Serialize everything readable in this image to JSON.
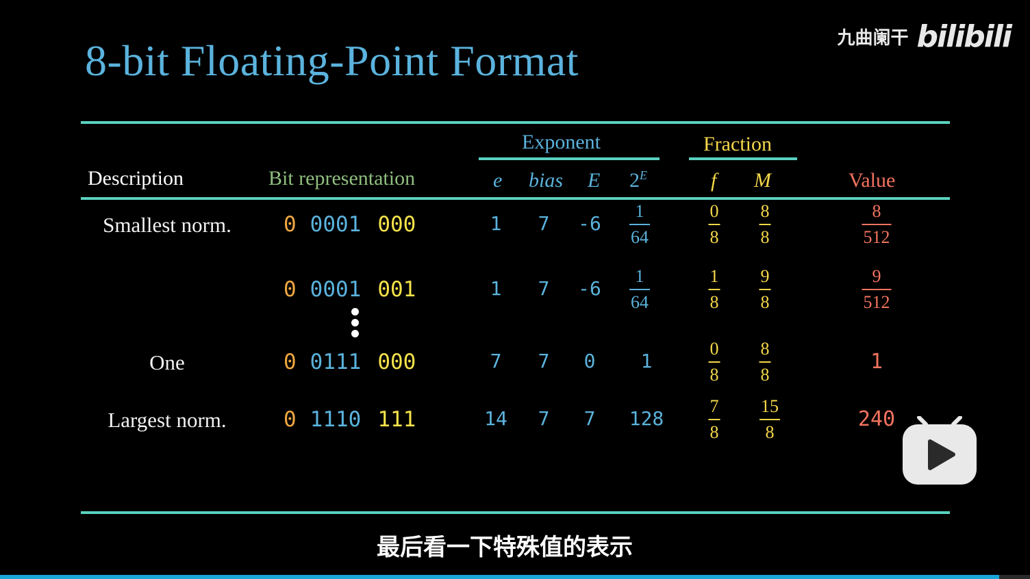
{
  "colors": {
    "title": "#5bb3dd",
    "rule": "#5ad1c0",
    "desc_header": "#ffffff",
    "bitrep_header": "#8fbf7f",
    "exponent": "#5bb3dd",
    "fraction": "#f5d84a",
    "value": "#f2735f",
    "sign": "#f0a840",
    "exp_bits": "#5bb3dd",
    "frac_bits": "#f5e34a"
  },
  "title": "8-bit Floating-Point Format",
  "watermark": {
    "channel": "九曲阑干",
    "logo": "bilibili"
  },
  "headers": {
    "exponent_group": "Exponent",
    "fraction_group": "Fraction",
    "description": "Description",
    "bit_representation": "Bit representation",
    "e": "e",
    "bias": "bias",
    "E": "E",
    "two_base": "2",
    "two_sup": "E",
    "f": "f",
    "M": "M",
    "value": "Value"
  },
  "rows": [
    {
      "description": "Smallest norm.",
      "sign": "0",
      "exp_bits": "0001",
      "frac_bits": "000",
      "e": "1",
      "bias": "7",
      "E": "-6",
      "two_E": {
        "num": "1",
        "den": "64"
      },
      "f": {
        "num": "0",
        "den": "8"
      },
      "M": {
        "num": "8",
        "den": "8"
      },
      "value": {
        "num": "8",
        "den": "512"
      }
    },
    {
      "description": "",
      "sign": "0",
      "exp_bits": "0001",
      "frac_bits": "001",
      "e": "1",
      "bias": "7",
      "E": "-6",
      "two_E": {
        "num": "1",
        "den": "64"
      },
      "f": {
        "num": "1",
        "den": "8"
      },
      "M": {
        "num": "9",
        "den": "8"
      },
      "value": {
        "num": "9",
        "den": "512"
      }
    },
    {
      "description": "One",
      "sign": "0",
      "exp_bits": "0111",
      "frac_bits": "000",
      "e": "7",
      "bias": "7",
      "E": "0",
      "two_E": "1",
      "f": {
        "num": "0",
        "den": "8"
      },
      "M": {
        "num": "8",
        "den": "8"
      },
      "value": "1"
    },
    {
      "description": "Largest norm.",
      "sign": "0",
      "exp_bits": "1110",
      "frac_bits": "111",
      "e": "14",
      "bias": "7",
      "E": "7",
      "two_E": "128",
      "f": {
        "num": "7",
        "den": "8"
      },
      "M": {
        "num": "15",
        "den": "8"
      },
      "value": "240"
    }
  ],
  "subtitle": "最后看一下特殊值的表示",
  "player": {
    "progress": 0.97
  }
}
